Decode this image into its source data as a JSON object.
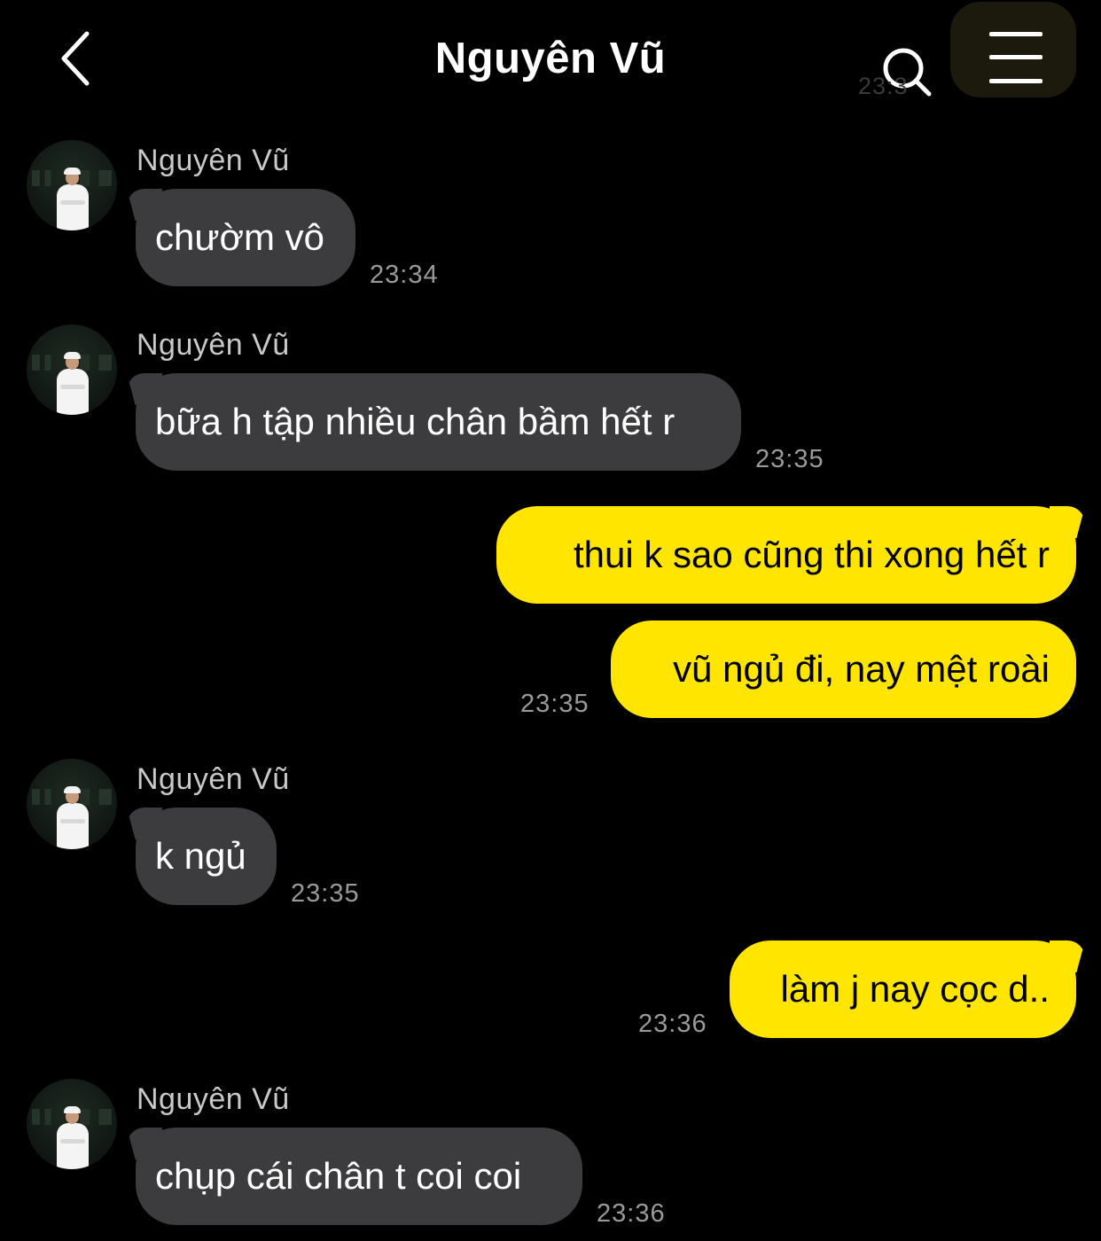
{
  "header": {
    "title": "Nguyên Vũ",
    "back_icon": "chevron-left-icon",
    "search_icon": "search-icon",
    "menu_icon": "hamburger-menu-icon",
    "ghost_time": "23:3"
  },
  "colors": {
    "background": "#000000",
    "incoming_bubble": "#3c3c3e",
    "outgoing_bubble": "#ffe500",
    "timestamp": "#9a9a9a",
    "sender_name": "#c9c9c9"
  },
  "messages": [
    {
      "direction": "in",
      "sender": "Nguyên Vũ",
      "text": "chườm vô",
      "time": "23:34"
    },
    {
      "direction": "in",
      "sender": "Nguyên Vũ",
      "text": "bữa h tập nhiều chân bầm hết r",
      "time": "23:35"
    },
    {
      "direction": "out",
      "text": "thui k sao cũng thi xong hết r"
    },
    {
      "direction": "out",
      "text": "vũ ngủ đi, nay mệt roài",
      "time": "23:35"
    },
    {
      "direction": "in",
      "sender": "Nguyên Vũ",
      "text": "k ngủ",
      "time": "23:35"
    },
    {
      "direction": "out",
      "text": "làm j nay cọc d..",
      "time": "23:36"
    },
    {
      "direction": "in",
      "sender": "Nguyên Vũ",
      "text": "chụp cái chân t coi coi",
      "time": "23:36"
    }
  ]
}
